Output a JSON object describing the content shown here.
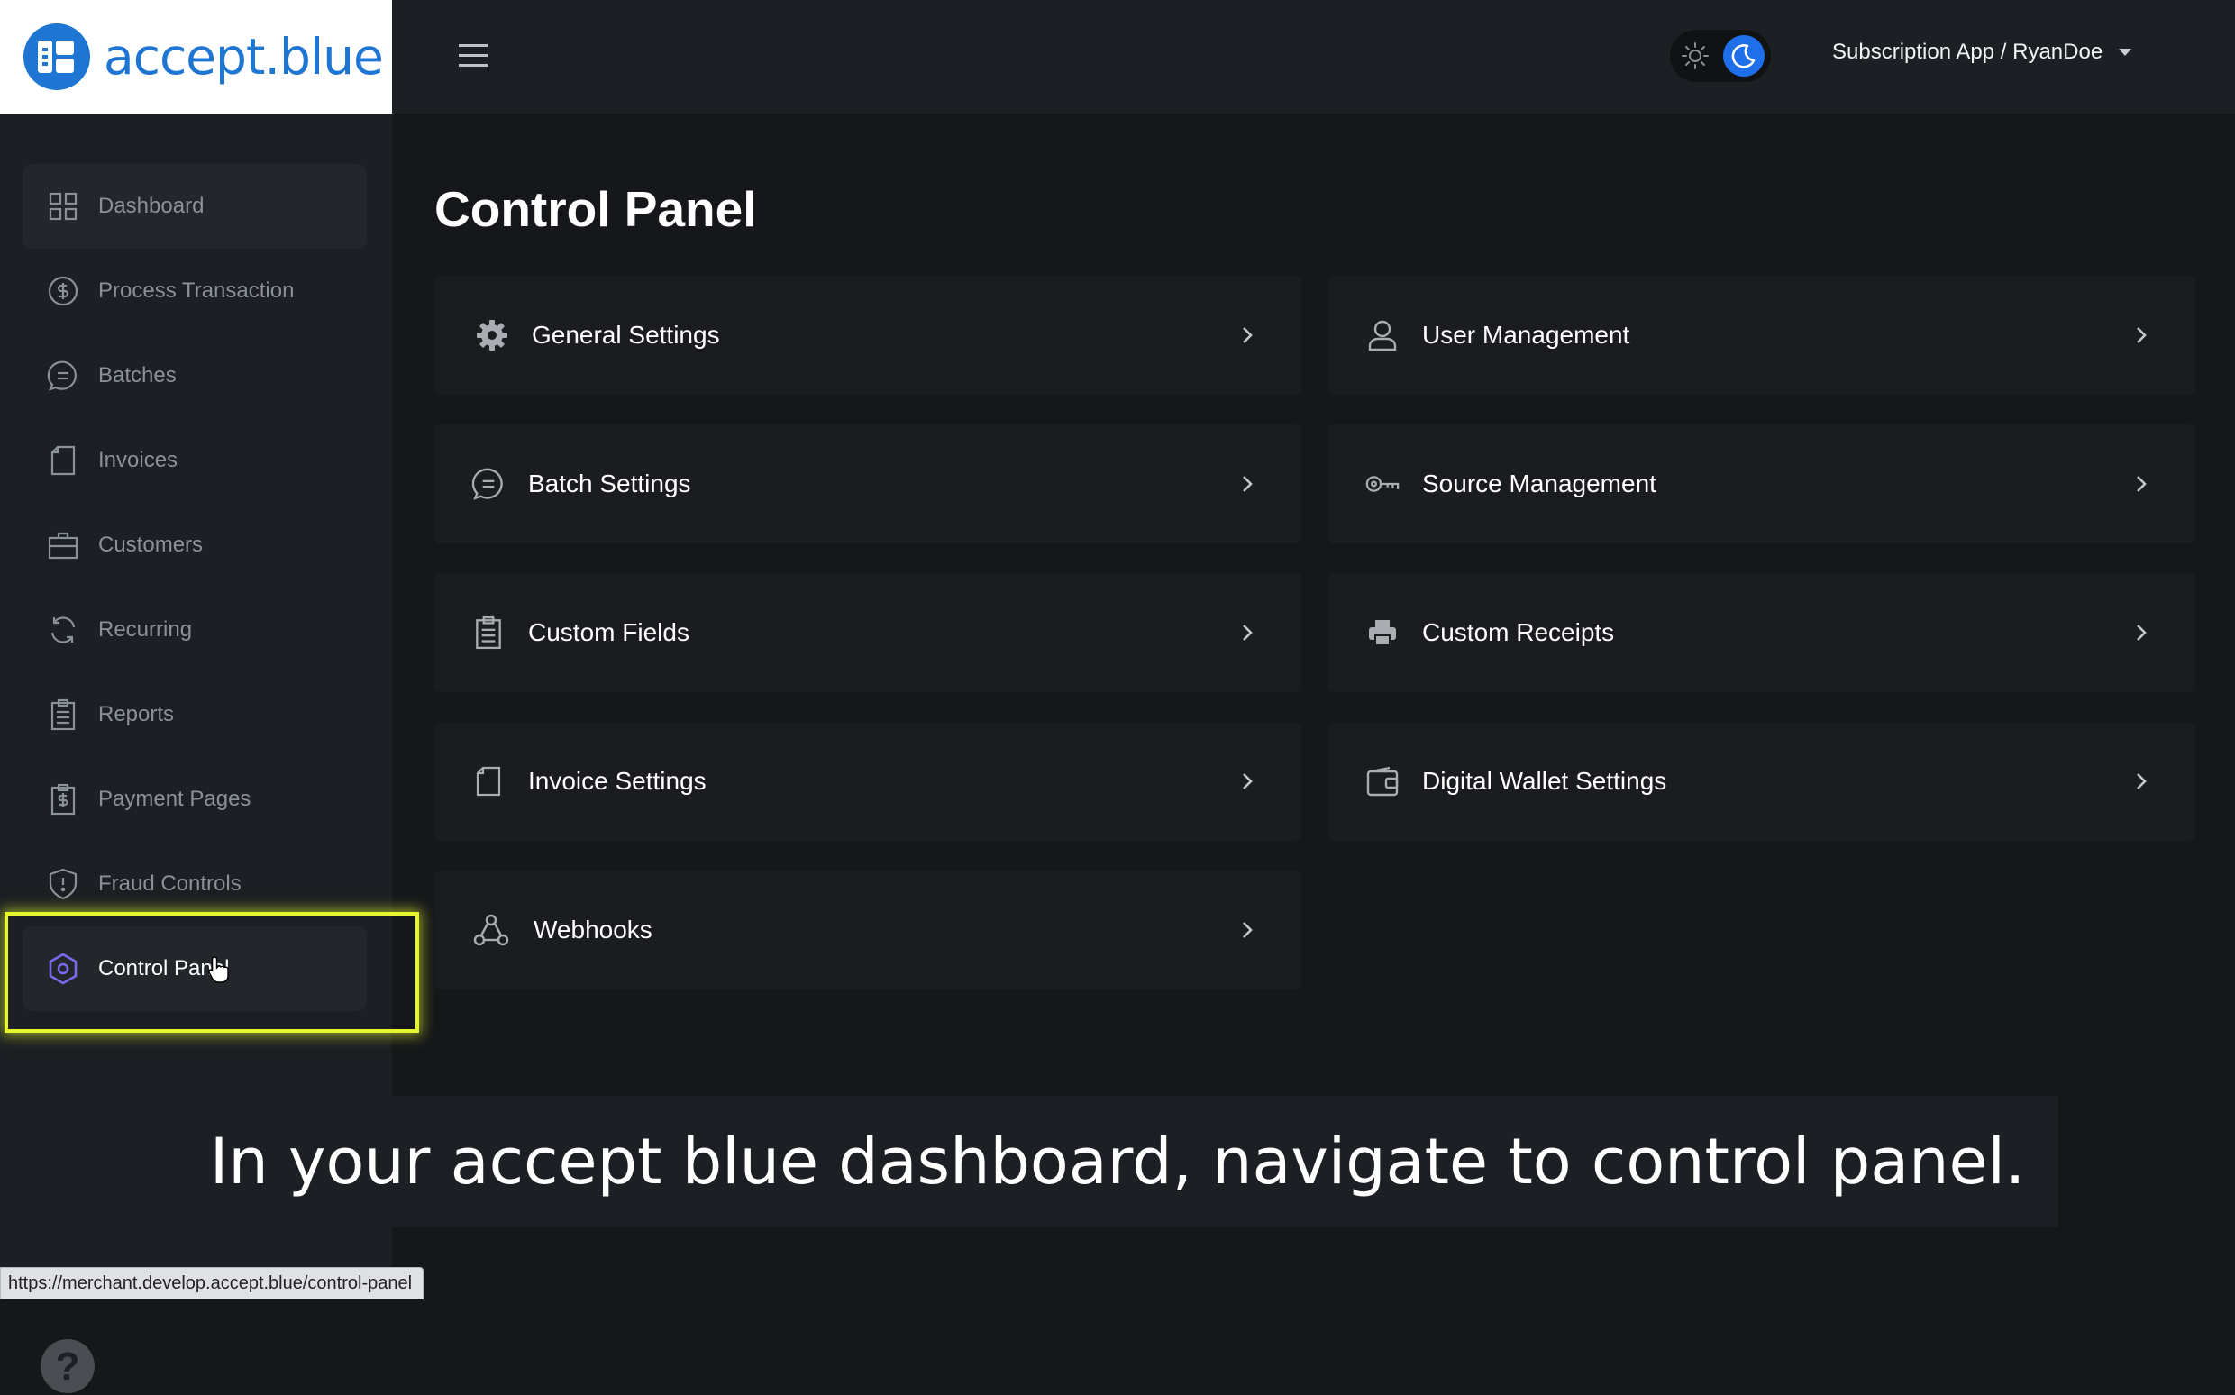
{
  "brand": {
    "logo_text": "accept.blue",
    "accent": "#1e76d2"
  },
  "header": {
    "menu_icon": "hamburger-icon",
    "theme_toggle": {
      "light_icon": "sun-icon",
      "dark_icon": "moon-icon",
      "selected": "dark"
    },
    "account_label": "Subscription App / RyanDoe"
  },
  "sidebar": {
    "items": [
      {
        "label": "Dashboard",
        "icon": "grid-icon"
      },
      {
        "label": "Process Transaction",
        "icon": "dollar-circle-icon"
      },
      {
        "label": "Batches",
        "icon": "batch-icon"
      },
      {
        "label": "Invoices",
        "icon": "invoice-icon"
      },
      {
        "label": "Customers",
        "icon": "briefcase-icon"
      },
      {
        "label": "Recurring",
        "icon": "refresh-icon"
      },
      {
        "label": "Reports",
        "icon": "clipboard-icon"
      },
      {
        "label": "Payment Pages",
        "icon": "dollar-doc-icon"
      },
      {
        "label": "Fraud Controls",
        "icon": "shield-icon"
      },
      {
        "label": "Control Panel",
        "icon": "hexagon-icon"
      }
    ],
    "help_label": "?"
  },
  "main": {
    "title": "Control Panel",
    "cards": [
      {
        "label": "General Settings",
        "icon": "gear-icon"
      },
      {
        "label": "User Management",
        "icon": "user-icon"
      },
      {
        "label": "Batch Settings",
        "icon": "batch-icon"
      },
      {
        "label": "Source Management",
        "icon": "key-icon"
      },
      {
        "label": "Custom Fields",
        "icon": "clipboard-icon"
      },
      {
        "label": "Custom Receipts",
        "icon": "printer-icon"
      },
      {
        "label": "Invoice Settings",
        "icon": "invoice-icon"
      },
      {
        "label": "Digital Wallet Settings",
        "icon": "wallet-icon"
      },
      {
        "label": "Webhooks",
        "icon": "webhook-icon"
      }
    ]
  },
  "caption": "In your accept blue dashboard, navigate to control panel.",
  "status_url": "https://merchant.develop.accept.blue/control-panel"
}
